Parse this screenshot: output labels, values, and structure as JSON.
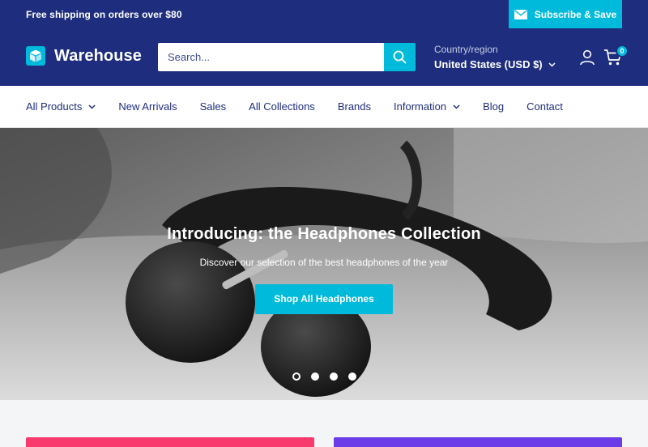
{
  "announcement": {
    "text": "Free shipping on orders over $80",
    "subscribe_label": "Subscribe & Save"
  },
  "header": {
    "logo_text": "Warehouse",
    "search_placeholder": "Search...",
    "country_label": "Country/region",
    "country_value": "United States (USD $)",
    "cart_count": "0"
  },
  "nav": {
    "items": [
      {
        "label": "All Products",
        "dropdown": true
      },
      {
        "label": "New Arrivals",
        "dropdown": false
      },
      {
        "label": "Sales",
        "dropdown": false
      },
      {
        "label": "All Collections",
        "dropdown": false
      },
      {
        "label": "Brands",
        "dropdown": false
      },
      {
        "label": "Information",
        "dropdown": true
      },
      {
        "label": "Blog",
        "dropdown": false
      },
      {
        "label": "Contact",
        "dropdown": false
      }
    ]
  },
  "hero": {
    "title": "Introducing: the Headphones Collection",
    "subtitle": "Discover our selection of the best headphones of the year",
    "button_label": "Shop All Headphones",
    "slide_count": 4,
    "active_slide": 1
  },
  "colors": {
    "primary": "#1e2d7d",
    "accent": "#00badb",
    "promo_pink": "#f83a6f",
    "promo_purple": "#6c3ce8"
  }
}
